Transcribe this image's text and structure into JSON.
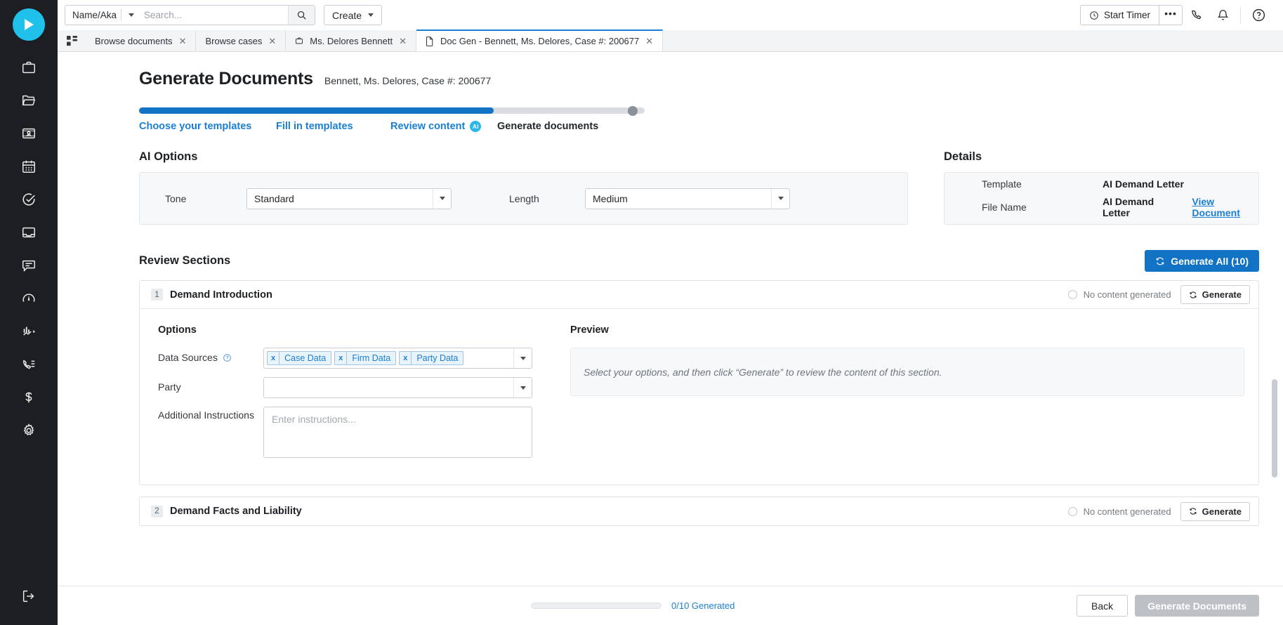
{
  "rail": {
    "logo_icon": "play-logo-icon",
    "items": [
      {
        "icon": "briefcase-icon",
        "name": "sidebar-item-matters"
      },
      {
        "icon": "folder-open-icon",
        "name": "sidebar-item-documents"
      },
      {
        "icon": "contact-card-icon",
        "name": "sidebar-item-contacts"
      },
      {
        "icon": "calendar-icon",
        "name": "sidebar-item-calendar"
      },
      {
        "icon": "check-circle-icon",
        "name": "sidebar-item-tasks"
      },
      {
        "icon": "inbox-icon",
        "name": "sidebar-item-inbox"
      },
      {
        "icon": "chat-icon",
        "name": "sidebar-item-messages"
      },
      {
        "icon": "speedometer-icon",
        "name": "sidebar-item-dashboard"
      },
      {
        "icon": "analytics-icon",
        "name": "sidebar-item-reports"
      },
      {
        "icon": "phone-list-icon",
        "name": "sidebar-item-calls"
      },
      {
        "icon": "dollar-icon",
        "name": "sidebar-item-billing"
      },
      {
        "icon": "gear-icon",
        "name": "sidebar-item-settings"
      }
    ],
    "bottom": {
      "icon": "logout-icon",
      "name": "sidebar-item-logout"
    }
  },
  "topbar": {
    "search_category": "Name/Aka",
    "search_placeholder": "Search...",
    "search_value": "",
    "search_icon": "search-icon",
    "create_label": "Create",
    "timer_label": "Start Timer",
    "timer_icon": "clock-icon",
    "more_label": "•••",
    "phone_icon": "phone-icon",
    "bell_icon": "bell-icon",
    "help_icon": "help-circle-icon"
  },
  "tabs": {
    "grid_icon": "grid-icon",
    "items": [
      {
        "label": "Browse documents",
        "icon": "",
        "active": false
      },
      {
        "label": "Browse cases",
        "icon": "",
        "active": false
      },
      {
        "label": "Ms. Delores Bennett",
        "icon": "briefcase-icon",
        "active": false
      },
      {
        "label": "Doc Gen - Bennett, Ms. Delores, Case #: 200677",
        "icon": "file-icon",
        "active": true
      }
    ],
    "close_label": "✕"
  },
  "page": {
    "title": "Generate Documents",
    "subtitle": "Bennett, Ms. Delores, Case #: 200677"
  },
  "stepper": {
    "steps": [
      {
        "label": "Choose your templates",
        "state": "done",
        "badge": ""
      },
      {
        "label": "Fill in templates",
        "state": "done",
        "badge": ""
      },
      {
        "label": "Review content",
        "state": "current",
        "badge": "AI"
      },
      {
        "label": "Generate documents",
        "state": "future",
        "badge": ""
      }
    ]
  },
  "ai_options": {
    "heading": "AI Options",
    "tone_label": "Tone",
    "tone_value": "Standard",
    "length_label": "Length",
    "length_value": "Medium"
  },
  "details": {
    "heading": "Details",
    "rows": [
      {
        "key": "Template",
        "value": "AI Demand Letter",
        "link": ""
      },
      {
        "key": "File Name",
        "value": "AI Demand Letter",
        "link": "View Document"
      }
    ]
  },
  "review": {
    "heading": "Review Sections",
    "generate_all_label": "Generate All (10)",
    "generate_all_icon": "refresh-icon"
  },
  "sections": [
    {
      "number": "1",
      "title": "Demand Introduction",
      "status": "No content generated",
      "generate_label": "Generate",
      "generate_icon": "refresh-icon",
      "options_heading": "Options",
      "data_sources_label": "Data Sources",
      "data_sources_help_icon": "help-circle-icon",
      "chips": [
        "Case Data",
        "Firm Data",
        "Party Data"
      ],
      "chip_remove": "x",
      "party_label": "Party",
      "party_value": "",
      "instructions_label": "Additional Instructions",
      "instructions_placeholder": "Enter instructions...",
      "instructions_value": "",
      "preview_heading": "Preview",
      "preview_text": "Select your options, and then click “Generate” to review the content of this section."
    },
    {
      "number": "2",
      "title": "Demand Facts and Liability",
      "status": "No content generated",
      "generate_label": "Generate",
      "generate_icon": "refresh-icon"
    }
  ],
  "footer": {
    "progress_text": "0/10 Generated",
    "progress_percent": 0,
    "back_label": "Back",
    "generate_documents_label": "Generate Documents"
  },
  "colors": {
    "accent": "#1273c4",
    "link": "#1a7fd4",
    "ai_badge": "#29b6e8",
    "rail_bg": "#1c1e21",
    "logo": "#1fc0ea"
  }
}
